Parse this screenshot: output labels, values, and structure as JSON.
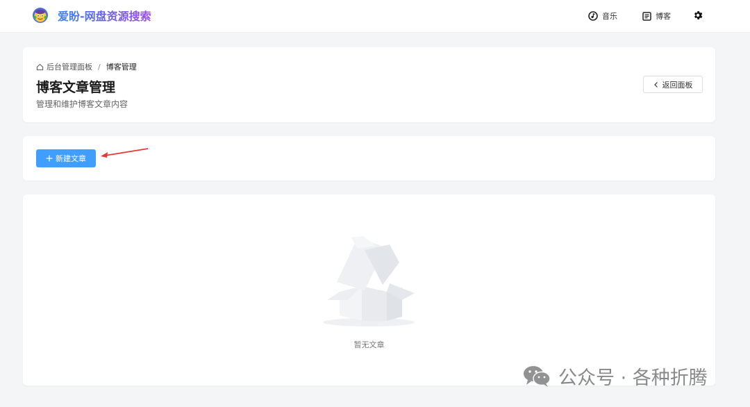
{
  "app": {
    "title": "爱盼-网盘资源搜索"
  },
  "nav": {
    "music_label": "音乐",
    "blog_label": "博客"
  },
  "breadcrumb": {
    "home_label": "后台管理面板",
    "separator": "/",
    "current_label": "博客管理"
  },
  "header": {
    "title": "博客文章管理",
    "subtitle": "管理和维护博客文章内容",
    "back_label": "返回面板"
  },
  "toolbar": {
    "new_label": "新建文章"
  },
  "list": {
    "empty_text": "暂无文章"
  },
  "watermark": {
    "text": "公众号 · 各种折腾"
  },
  "colors": {
    "primary": "#409eff",
    "annotation_arrow": "#e53935",
    "brand_gradient_start": "#3b82f6",
    "brand_gradient_end": "#9b4df2"
  },
  "icons": {
    "logo": "cartoon-logo-icon",
    "music": "music-disc-icon",
    "blog": "document-list-icon",
    "settings": "gear-icon",
    "home": "home-icon",
    "back": "chevron-left-icon",
    "plus": "plus-icon",
    "empty": "empty-box-icon",
    "wechat": "wechat-icon"
  }
}
